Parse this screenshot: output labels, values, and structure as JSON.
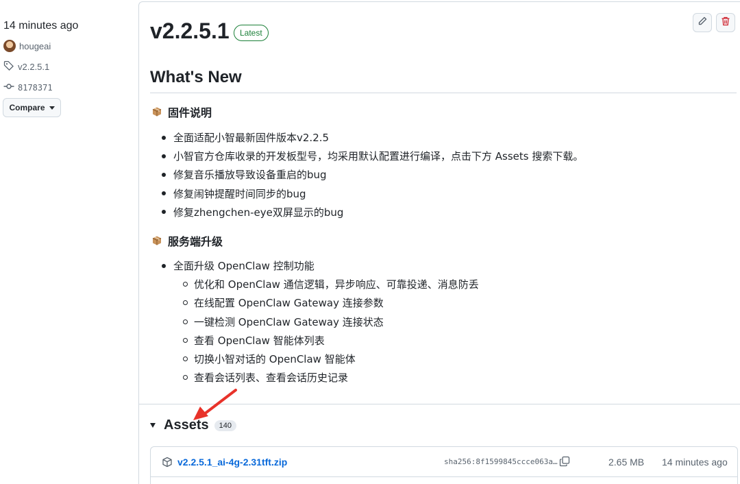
{
  "sidebar": {
    "time": "14 minutes ago",
    "author": "hougeai",
    "tag": "v2.2.5.1",
    "commit": "8178371",
    "compare_label": "Compare"
  },
  "release": {
    "title": "v2.2.5.1",
    "latest_badge": "Latest",
    "heading": "What's New",
    "sections": [
      {
        "title": "固件说明",
        "items": [
          "全面适配小智最新固件版本v2.2.5",
          "小智官方仓库收录的开发板型号，均采用默认配置进行编译，点击下方 Assets 搜索下载。",
          "修复音乐播放导致设备重启的bug",
          "修复闹钟提醒时间同步的bug",
          "修复zhengchen-eye双屏显示的bug"
        ]
      },
      {
        "title": "服务端升级",
        "items": [
          "全面升级 OpenClaw 控制功能"
        ],
        "subitems": [
          "优化和 OpenClaw 通信逻辑，异步响应、可靠投递、消息防丢",
          "在线配置 OpenClaw Gateway 连接参数",
          "一键检测 OpenClaw Gateway 连接状态",
          "查看 OpenClaw 智能体列表",
          "切换小智对话的 OpenClaw 智能体",
          "查看会话列表、查看会话历史记录"
        ]
      }
    ]
  },
  "assets": {
    "title": "Assets",
    "count": "140",
    "rows": [
      {
        "name": "v2.2.5.1_ai-4g-2.31tft.zip",
        "sha": "sha256:8f1599845ccce063a…",
        "size": "2.65 MB",
        "time": "14 minutes ago"
      }
    ]
  },
  "colors": {
    "accent_link": "#0969da",
    "latest_green": "#1a7f37",
    "delete_red": "#cf222e",
    "annotation_arrow": "#e8322a"
  }
}
